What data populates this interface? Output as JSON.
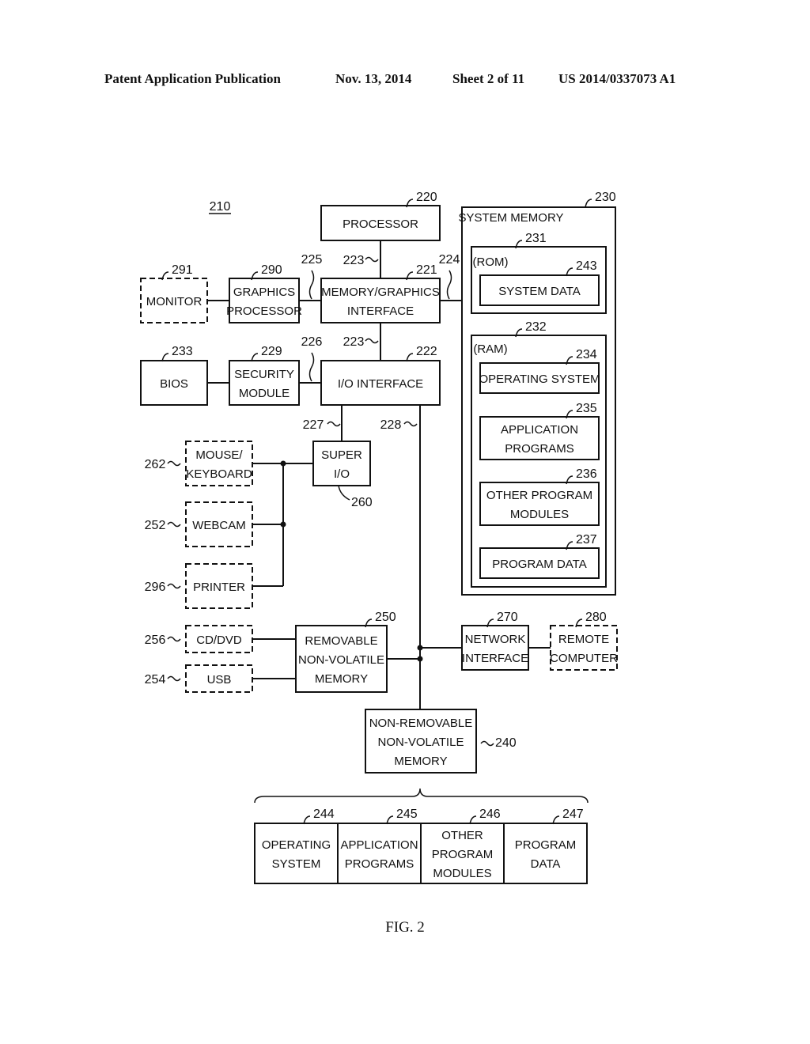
{
  "header": {
    "publication": "Patent Application Publication",
    "date": "Nov. 13, 2014",
    "sheet": "Sheet 2 of 11",
    "number": "US 2014/0337073 A1"
  },
  "figure_label": "FIG. 2",
  "system_ref": "210",
  "blocks": {
    "processor": {
      "ref": "220",
      "lines": [
        "PROCESSOR"
      ]
    },
    "mem_graphics": {
      "ref": "221",
      "lines": [
        "MEMORY/GRAPHICS",
        "INTERFACE"
      ]
    },
    "io_interface": {
      "ref": "222",
      "lines": [
        "I/O INTERFACE"
      ]
    },
    "monitor": {
      "ref": "291",
      "lines": [
        "MONITOR"
      ]
    },
    "graphics_processor": {
      "ref": "290",
      "lines": [
        "GRAPHICS",
        "PROCESSOR"
      ]
    },
    "bios": {
      "ref": "233",
      "lines": [
        "BIOS"
      ]
    },
    "security_module": {
      "ref": "229",
      "lines": [
        "SECURITY",
        "MODULE"
      ]
    },
    "super_io": {
      "ref": "260",
      "lines": [
        "SUPER",
        "I/O"
      ]
    },
    "mouse_keyboard": {
      "ref": "262",
      "lines": [
        "MOUSE/",
        "KEYBOARD"
      ]
    },
    "webcam": {
      "ref": "252",
      "lines": [
        "WEBCAM"
      ]
    },
    "printer": {
      "ref": "296",
      "lines": [
        "PRINTER"
      ]
    },
    "cd_dvd": {
      "ref": "256",
      "lines": [
        "CD/DVD"
      ]
    },
    "usb": {
      "ref": "254",
      "lines": [
        "USB"
      ]
    },
    "removable_memory": {
      "ref": "250",
      "lines": [
        "REMOVABLE",
        "NON-VOLATILE",
        "MEMORY"
      ]
    },
    "network_interface": {
      "ref": "270",
      "lines": [
        "NETWORK",
        "INTERFACE"
      ]
    },
    "remote_computer": {
      "ref": "280",
      "lines": [
        "REMOTE",
        "COMPUTER"
      ]
    },
    "non_removable_memory": {
      "ref": "240",
      "lines": [
        "NON-REMOVABLE",
        "NON-VOLATILE",
        "MEMORY"
      ]
    }
  },
  "system_memory": {
    "ref": "230",
    "title": "SYSTEM MEMORY",
    "rom": {
      "ref": "231",
      "label": "(ROM)",
      "system_data": {
        "ref": "243",
        "label": "SYSTEM DATA"
      }
    },
    "ram": {
      "ref": "232",
      "label": "(RAM)",
      "items": [
        {
          "ref": "234",
          "lines": [
            "OPERATING SYSTEM"
          ]
        },
        {
          "ref": "235",
          "lines": [
            "APPLICATION",
            "PROGRAMS"
          ]
        },
        {
          "ref": "236",
          "lines": [
            "OTHER PROGRAM",
            "MODULES"
          ]
        },
        {
          "ref": "237",
          "lines": [
            "PROGRAM DATA"
          ]
        }
      ]
    }
  },
  "storage_items": [
    {
      "ref": "244",
      "lines": [
        "OPERATING",
        "SYSTEM"
      ]
    },
    {
      "ref": "245",
      "lines": [
        "APPLICATION",
        "PROGRAMS"
      ]
    },
    {
      "ref": "246",
      "lines": [
        "OTHER",
        "PROGRAM",
        "MODULES"
      ]
    },
    {
      "ref": "247",
      "lines": [
        "PROGRAM",
        "DATA"
      ]
    }
  ],
  "buses": {
    "b223a": "223",
    "b223b": "223",
    "b224": "224",
    "b225": "225",
    "b226": "226",
    "b227": "227",
    "b228": "228"
  }
}
